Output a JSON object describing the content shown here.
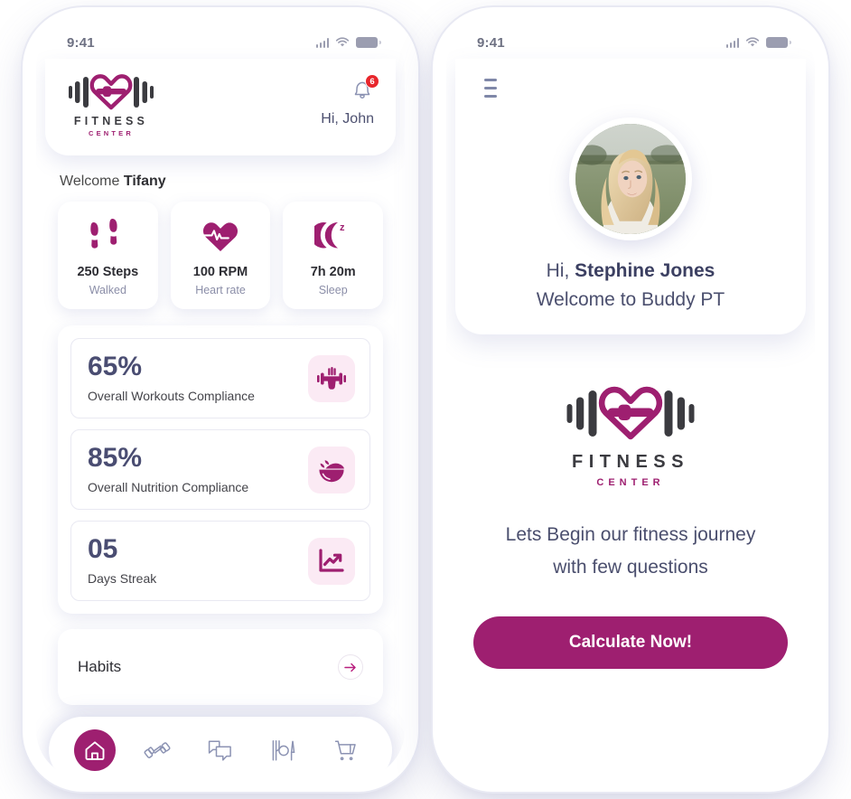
{
  "brand": {
    "accent": "#9e1f70",
    "accent_soft": "#fbeaf4",
    "slate": "#4b4f6e",
    "badge_red": "#e8262c",
    "logo_word": "FITNESS",
    "logo_sub": "CENTER"
  },
  "left_phone": {
    "status_bar": {
      "time": "9:41",
      "icons": [
        "signal-icon",
        "wifi-icon",
        "battery-icon"
      ]
    },
    "header": {
      "logo_icon": "fitness-center-logo",
      "notification_icon": "bell-icon",
      "notification_count": "6",
      "greeting": "Hi, John"
    },
    "welcome": {
      "prefix": "Welcome ",
      "name": "Tifany"
    },
    "stats": [
      {
        "icon": "footsteps-icon",
        "value": "250 Steps",
        "label": "Walked"
      },
      {
        "icon": "heart-pulse-icon",
        "value": "100 RPM",
        "label": "Heart rate"
      },
      {
        "icon": "moon-sleep-icon",
        "value": "7h 20m",
        "label": "Sleep"
      }
    ],
    "compliance": [
      {
        "value": "65%",
        "label": "Overall Workouts Compliance",
        "icon": "dumbbell-hand-icon"
      },
      {
        "value": "85%",
        "label": "Overall Nutrition Compliance",
        "icon": "salad-bowl-icon"
      },
      {
        "value": "05",
        "label": "Days Streak",
        "icon": "trending-chart-icon"
      }
    ],
    "habits": {
      "title": "Habits",
      "arrow_icon": "arrow-right-icon"
    },
    "tabbar": [
      {
        "icon": "home-icon",
        "active": true
      },
      {
        "icon": "dumbbell-icon",
        "active": false
      },
      {
        "icon": "chat-icon",
        "active": false
      },
      {
        "icon": "meal-plate-icon",
        "active": false
      },
      {
        "icon": "cart-icon",
        "active": false
      }
    ]
  },
  "right_phone": {
    "status_bar": {
      "time": "9:41",
      "icons": [
        "signal-icon",
        "wifi-icon",
        "battery-icon"
      ]
    },
    "menu_icon": "hamburger-menu-icon",
    "avatar": "user-avatar-photo",
    "greeting_prefix": "Hi, ",
    "greeting_name": "Stephine Jones",
    "welcome_text": "Welcome to Buddy PT",
    "logo_icon": "fitness-center-logo",
    "tagline_line1": "Lets Begin our fitness journey",
    "tagline_line2": "with few questions",
    "cta_label": "Calculate Now!"
  }
}
